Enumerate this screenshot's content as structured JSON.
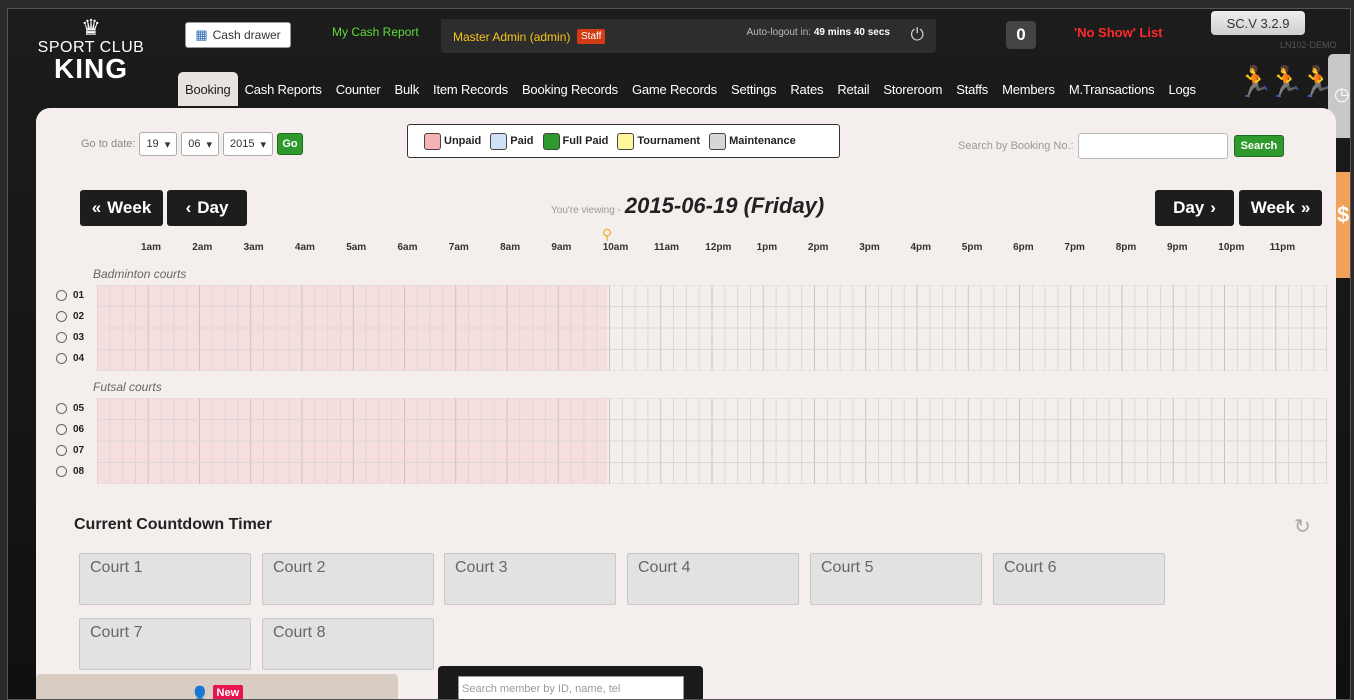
{
  "brand": {
    "line1": "SPORT CLUB",
    "line2": "KING"
  },
  "header": {
    "cash_drawer": "Cash drawer",
    "my_cash_report": "My Cash Report",
    "admin_name": "Master Admin (admin)",
    "staff_badge": "Staff",
    "auto_logout_label": "Auto-logout in:",
    "auto_logout_time": "49 mins 40 secs",
    "counter": "0",
    "no_show": "'No Show' List",
    "version": "SC.V 3.2.9",
    "site": "LN102-DEMO"
  },
  "nav": [
    "Booking",
    "Cash Reports",
    "Counter",
    "Bulk",
    "Item Records",
    "Booking Records",
    "Game Records",
    "Settings",
    "Rates",
    "Retail",
    "Storeroom",
    "Staffs",
    "Members",
    "M.Transactions",
    "Logs"
  ],
  "goto": {
    "label": "Go to date:",
    "day": "19",
    "month": "06",
    "year": "2015",
    "go": "Go"
  },
  "legend": [
    {
      "label": "Unpaid",
      "color": "#f5b3b3"
    },
    {
      "label": "Paid",
      "color": "#cfe0f7"
    },
    {
      "label": "Full Paid",
      "color": "#2e9a2e"
    },
    {
      "label": "Tournament",
      "color": "#fff59a"
    },
    {
      "label": "Maintenance",
      "color": "#d6d6d6"
    }
  ],
  "search_booking": {
    "label": "Search by Booking No.:",
    "value": "",
    "button": "Search"
  },
  "day_nav": {
    "prev_week": "Week",
    "prev_day": "Day",
    "next_day": "Day",
    "next_week": "Week",
    "viewing_prefix": "You're viewing -",
    "viewing_date": "2015-06-19 (Friday)"
  },
  "hours": [
    "1am",
    "2am",
    "3am",
    "4am",
    "5am",
    "6am",
    "7am",
    "8am",
    "9am",
    "10am",
    "11am",
    "12pm",
    "1pm",
    "2pm",
    "3pm",
    "4pm",
    "5pm",
    "6pm",
    "7pm",
    "8pm",
    "9pm",
    "10pm",
    "11pm"
  ],
  "groups": [
    {
      "name": "Badminton courts",
      "courts": [
        "01",
        "02",
        "03",
        "04"
      ]
    },
    {
      "name": "Futsal courts",
      "courts": [
        "05",
        "06",
        "07",
        "08"
      ]
    }
  ],
  "countdown": {
    "title": "Current Countdown Timer",
    "courts": [
      "Court 1",
      "Court 2",
      "Court 3",
      "Court 4",
      "Court 5",
      "Court 6",
      "Court 7",
      "Court 8"
    ]
  },
  "bottom": {
    "new_badge": "New",
    "member_search_placeholder": "Search member by ID, name, tel"
  }
}
